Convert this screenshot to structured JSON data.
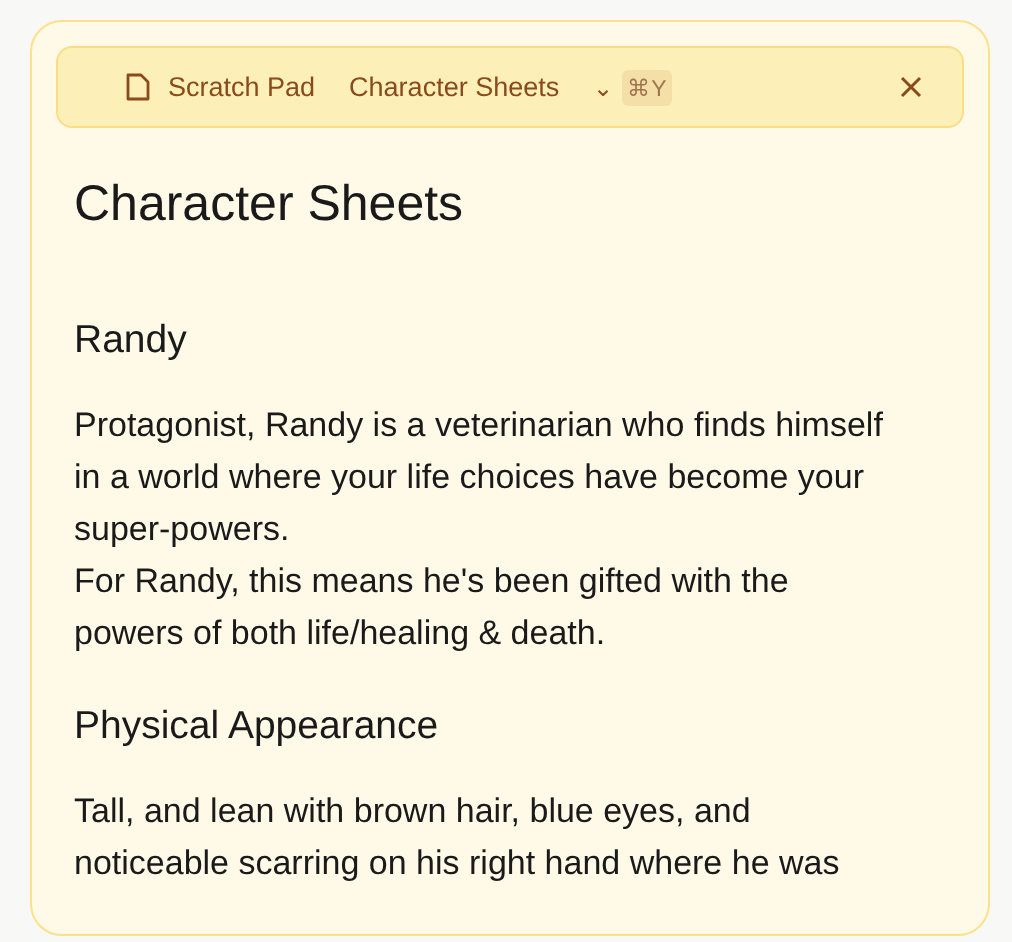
{
  "toolbar": {
    "breadcrumb": [
      {
        "kind": "file",
        "label": "Scratch Pad"
      },
      {
        "kind": "doc",
        "label": "Character Sheets"
      }
    ],
    "dropdown": "⌄",
    "shortcut": "⌘Y"
  },
  "document": {
    "title": "Character Sheets",
    "sections": [
      {
        "heading": "Randy",
        "lines": [
          "Protagonist, Randy is a veterinarian who finds himself",
          "in a world where your life choices have become your",
          "super-powers.",
          "For Randy, this means he's been gifted with the",
          "powers of both life/healing & death."
        ]
      },
      {
        "heading": "Physical Appearance",
        "lines": [
          "Tall, and lean with brown hair, blue eyes, and",
          "noticeable scarring on his right hand where he was"
        ]
      }
    ]
  }
}
